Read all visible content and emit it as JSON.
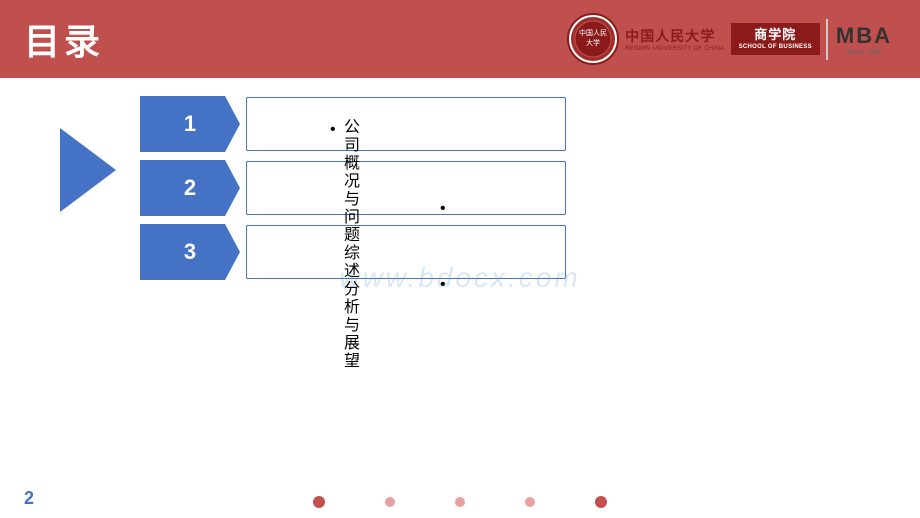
{
  "header": {
    "title": "目录",
    "bg_color": "#c0504d"
  },
  "logo": {
    "circle_text": "中国\n人民\n大学",
    "cn_name": "中国人民大学",
    "en_name": "RENMIN UNIVERSITY OF CHINA",
    "school": "商学院",
    "school_en": "SCHOOL OF BUSINESS",
    "mba": "MBA",
    "mba_sub": "Since 1990"
  },
  "arrow": {
    "color": "#4472c4"
  },
  "items": [
    {
      "number": "1",
      "label": ""
    },
    {
      "number": "2",
      "label": ""
    },
    {
      "number": "3",
      "label": ""
    }
  ],
  "bullet_text": "公司概况与问题综述分析与展望",
  "bullet_lines": [
    "公司概况",
    "与",
    "问题综述",
    "分析与展望"
  ],
  "watermark": "www.bdocx.com",
  "footer": {
    "page_number": "2",
    "dots": [
      "active",
      "inactive",
      "inactive",
      "inactive",
      "inactive"
    ]
  }
}
